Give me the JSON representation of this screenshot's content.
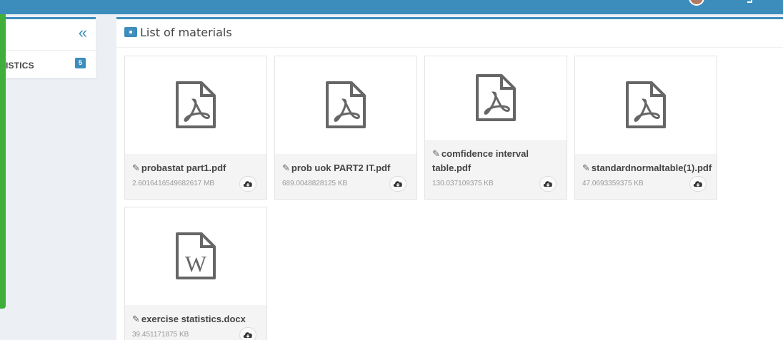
{
  "sidebar": {
    "collapse_icon": "double-chevron-left-icon",
    "item": {
      "label": "ISTICS",
      "badge": "5"
    }
  },
  "main": {
    "title_icon": "camera-icon",
    "title": "List of materials"
  },
  "files": [
    {
      "name": "probastat part1.pdf",
      "size": "2.6016416549682617 MB",
      "type": "pdf",
      "icon": "pdf-file-icon"
    },
    {
      "name": "prob uok PART2 IT.pdf",
      "size": "689.0048828125 KB",
      "type": "pdf",
      "icon": "pdf-file-icon"
    },
    {
      "name": "comfidence interval table.pdf",
      "size": "130.037109375 KB",
      "type": "pdf",
      "icon": "pdf-file-icon"
    },
    {
      "name": "standardnormaltable(1).pdf",
      "size": "47.0693359375 KB",
      "type": "pdf",
      "icon": "pdf-file-icon"
    },
    {
      "name": "exercise statistics.docx",
      "size": "39.451171875 KB",
      "type": "docx",
      "icon": "word-file-icon"
    }
  ],
  "colors": {
    "accent": "#3c8dbc",
    "green_bar": "#3fae3b",
    "icon_gray": "#666666"
  }
}
